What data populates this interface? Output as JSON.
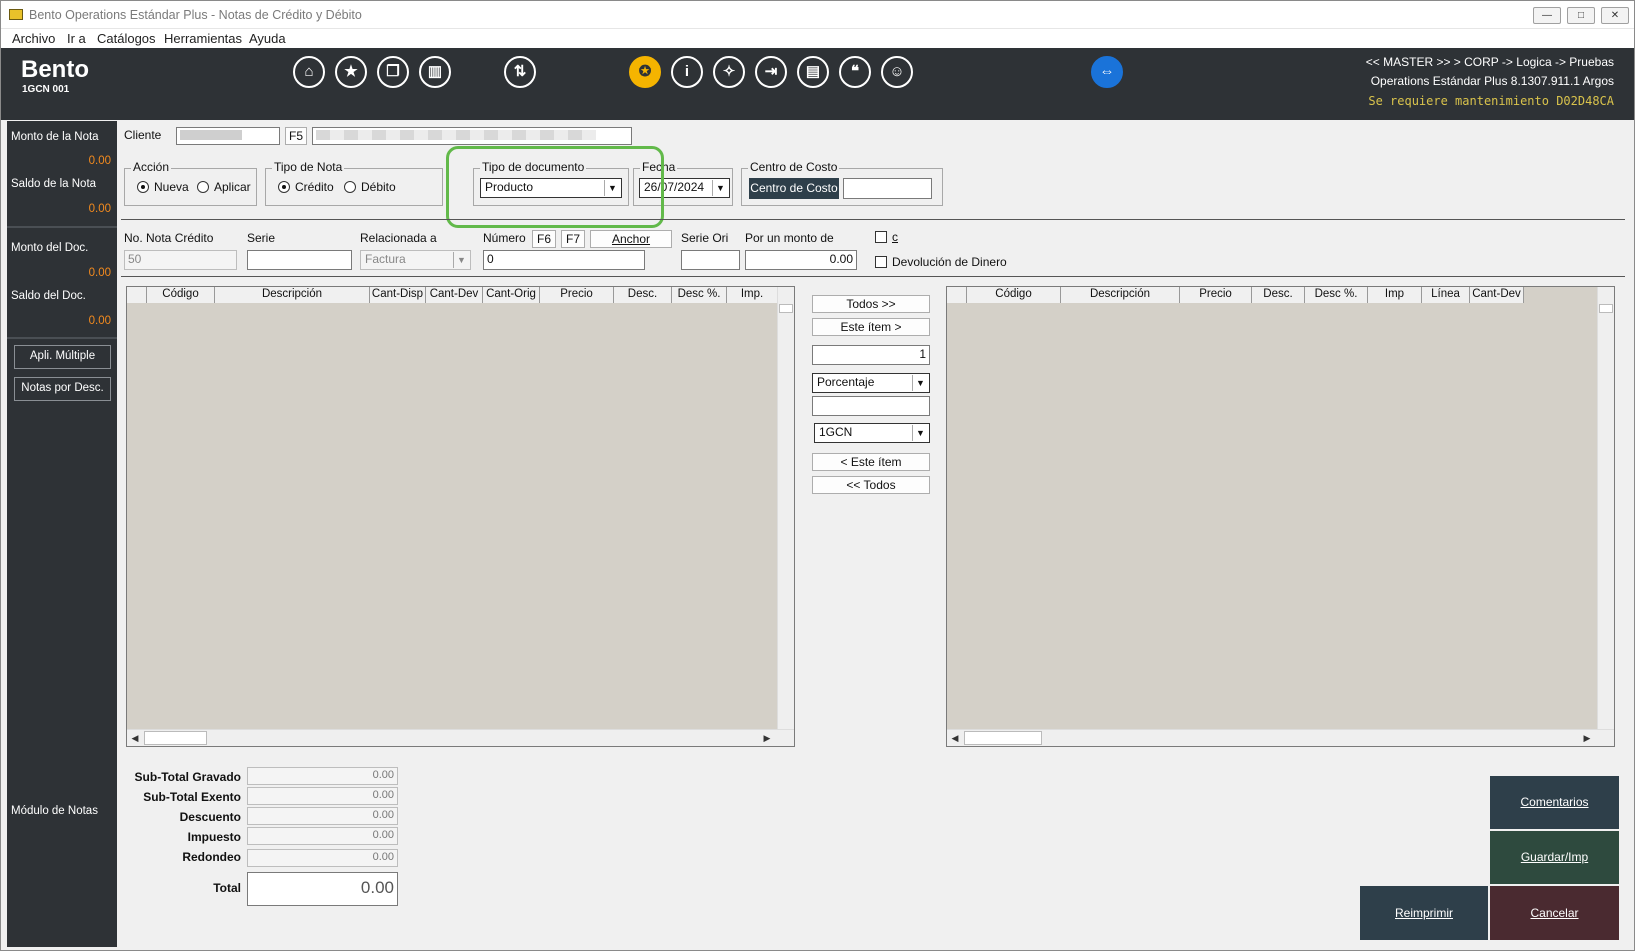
{
  "window": {
    "title": "Bento Operations Estándar Plus - Notas de Crédito y Débito",
    "minimize": "—",
    "maximize": "□",
    "close": "✕"
  },
  "menu": [
    "Archivo",
    "Ir a",
    "Catálogos",
    "Herramientas",
    "Ayuda"
  ],
  "header": {
    "brand": "Bento",
    "sub": "1GCN 001",
    "path": "<< MASTER >> > CORP -> Logica -> Pruebas",
    "version": "Operations Estándar Plus 8.1307.911.1 Argos",
    "warning": "Se requiere mantenimiento D02D48CA",
    "icons": [
      "home-icon",
      "star-icon",
      "copy-icon",
      "book-icon",
      "sort-icon",
      "award-icon",
      "info-icon",
      "lightbulb-icon",
      "login-icon",
      "id-card-icon",
      "quote-icon",
      "support-icon",
      "teamviewer-icon"
    ]
  },
  "sidebar": {
    "monto_nota_label": "Monto de la Nota",
    "monto_nota_value": "0.00",
    "saldo_nota_label": "Saldo de la Nota",
    "saldo_nota_value": "0.00",
    "monto_doc_label": "Monto del Doc.",
    "monto_doc_value": "0.00",
    "saldo_doc_label": "Saldo del Doc.",
    "saldo_doc_value": "0.00",
    "apli_multiple": "Apli. Múltiple",
    "notas_desc": "Notas por Desc.",
    "modulo": "Módulo de Notas"
  },
  "form": {
    "cliente_label": "Cliente",
    "f5": "F5",
    "accion_title": "Acción",
    "accion_nueva": "Nueva",
    "accion_aplicar": "Aplicar",
    "tipo_nota_title": "Tipo de Nota",
    "tipo_credito": "Crédito",
    "tipo_debito": "Débito",
    "tipo_doc_title": "Tipo de documento",
    "tipo_doc_value": "Producto",
    "fecha_title": "Fecha",
    "fecha_value": "26/07/2024",
    "centro_title": "Centro de Costo",
    "centro_btn": "Centro de Costo",
    "no_nota_label": "No. Nota Crédito",
    "no_nota_value": "50",
    "serie_label": "Serie",
    "relacionada_label": "Relacionada a",
    "relacionada_value": "Factura",
    "numero_label": "Número",
    "numero_value": "0",
    "f6": "F6",
    "f7": "F7",
    "anchor": "Anchor",
    "serie_ori_label": "Serie Ori",
    "monto_label": "Por un monto de",
    "monto_value": "0.00",
    "chk_c": "c",
    "devolucion": "Devolución de Dinero"
  },
  "left_grid": {
    "columns": [
      "Código",
      "Descripción",
      "Cant-Disp",
      "Cant-Dev",
      "Cant-Orig",
      "Precio",
      "Desc.",
      "Desc %.",
      "Imp."
    ]
  },
  "right_grid": {
    "columns": [
      "Código",
      "Descripción",
      "Precio",
      "Desc.",
      "Desc %.",
      "Imp",
      "Línea",
      "Cant-Dev"
    ]
  },
  "middle": {
    "todos_right": "Todos >>",
    "este_right": "Este ítem >",
    "qty": "1",
    "porcentaje": "Porcentaje",
    "code": "1GCN",
    "este_left": "< Este ítem",
    "todos_left": "<< Todos"
  },
  "totals": {
    "subtotal_gravado_label": "Sub-Total Gravado",
    "subtotal_gravado": "0.00",
    "subtotal_exento_label": "Sub-Total Exento",
    "subtotal_exento": "0.00",
    "descuento_label": "Descuento",
    "descuento": "0.00",
    "impuesto_label": "Impuesto",
    "impuesto": "0.00",
    "redondeo_label": "Redondeo",
    "redondeo": "0.00",
    "total_label": "Total",
    "total": "0.00"
  },
  "actions": {
    "comentarios": "Comentarios",
    "guardar": "Guardar/Imp",
    "reimprimir": "Reimprimir",
    "cancelar": "Cancelar"
  },
  "colors": {
    "header_bg": "#2e3236",
    "accent_orange": "#f28a1e",
    "highlight_green": "#62b94a",
    "comentarios_bg": "#2e3f4a",
    "guardar_bg": "#2e4a3e",
    "reimprimir_bg": "#2e3f4a",
    "cancelar_bg": "#4a2a30"
  }
}
